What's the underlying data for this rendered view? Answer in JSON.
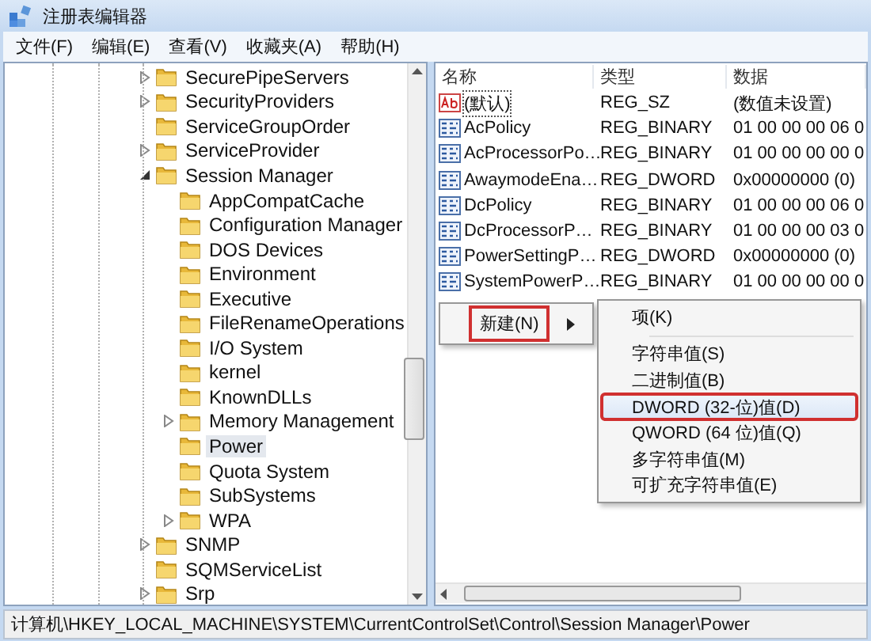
{
  "window": {
    "title": "注册表编辑器"
  },
  "menu": [
    "文件(F)",
    "编辑(E)",
    "查看(V)",
    "收藏夹(A)",
    "帮助(H)"
  ],
  "tree": {
    "items": [
      {
        "label": "SecurePipeServers",
        "expandable": true,
        "expanded": false,
        "selected": false
      },
      {
        "label": "SecurityProviders",
        "expandable": true,
        "expanded": false,
        "selected": false
      },
      {
        "label": "ServiceGroupOrder",
        "expandable": false,
        "selected": false
      },
      {
        "label": "ServiceProvider",
        "expandable": true,
        "expanded": false,
        "selected": false
      },
      {
        "label": "Session Manager",
        "expandable": true,
        "expanded": true,
        "selected": false,
        "children": [
          {
            "label": "AppCompatCache",
            "expandable": false,
            "selected": false
          },
          {
            "label": "Configuration Manager",
            "expandable": false,
            "selected": false
          },
          {
            "label": "DOS Devices",
            "expandable": false,
            "selected": false
          },
          {
            "label": "Environment",
            "expandable": false,
            "selected": false
          },
          {
            "label": "Executive",
            "expandable": false,
            "selected": false
          },
          {
            "label": "FileRenameOperations",
            "expandable": false,
            "selected": false
          },
          {
            "label": "I/O System",
            "expandable": false,
            "selected": false
          },
          {
            "label": "kernel",
            "expandable": false,
            "selected": false
          },
          {
            "label": "KnownDLLs",
            "expandable": false,
            "selected": false
          },
          {
            "label": "Memory Management",
            "expandable": true,
            "expanded": false,
            "selected": false
          },
          {
            "label": "Power",
            "expandable": false,
            "selected": true
          },
          {
            "label": "Quota System",
            "expandable": false,
            "selected": false
          },
          {
            "label": "SubSystems",
            "expandable": false,
            "selected": false
          },
          {
            "label": "WPA",
            "expandable": true,
            "expanded": false,
            "selected": false
          }
        ]
      },
      {
        "label": "SNMP",
        "expandable": true,
        "expanded": false,
        "selected": false
      },
      {
        "label": "SQMServiceList",
        "expandable": false,
        "selected": false
      },
      {
        "label": "Srp",
        "expandable": true,
        "expanded": false,
        "selected": false
      }
    ]
  },
  "list": {
    "columns": [
      "名称",
      "类型",
      "数据"
    ],
    "rows": [
      {
        "kind": "string",
        "name": "(默认)",
        "type": "REG_SZ",
        "data": "(数值未设置)",
        "focused": true
      },
      {
        "kind": "binary",
        "name": "AcPolicy",
        "type": "REG_BINARY",
        "data": "01 00 00 00 06 0",
        "focused": false
      },
      {
        "kind": "binary",
        "name": "AcProcessorPo…",
        "type": "REG_BINARY",
        "data": "01 00 00 00 00 0",
        "focused": false
      },
      {
        "kind": "binary",
        "name": "AwaymodeEna…",
        "type": "REG_DWORD",
        "data": "0x00000000 (0)",
        "focused": false
      },
      {
        "kind": "binary",
        "name": "DcPolicy",
        "type": "REG_BINARY",
        "data": "01 00 00 00 06 0",
        "focused": false
      },
      {
        "kind": "binary",
        "name": "DcProcessorP…",
        "type": "REG_BINARY",
        "data": "01 00 00 00 03 0",
        "focused": false
      },
      {
        "kind": "binary",
        "name": "PowerSettingP…",
        "type": "REG_DWORD",
        "data": "0x00000000 (0)",
        "focused": false
      },
      {
        "kind": "binary",
        "name": "SystemPowerP…",
        "type": "REG_BINARY",
        "data": "01 00 00 00 00 0",
        "focused": false
      }
    ]
  },
  "context_menu": {
    "items": [
      {
        "label": "新建(N)",
        "annotated": true,
        "submenu": true
      }
    ]
  },
  "submenu": {
    "items": [
      {
        "kind": "item",
        "label": "项(K)",
        "selected": false,
        "annotated": false
      },
      {
        "kind": "separator"
      },
      {
        "kind": "item",
        "label": "字符串值(S)",
        "selected": false,
        "annotated": false
      },
      {
        "kind": "item",
        "label": "二进制值(B)",
        "selected": false,
        "annotated": false
      },
      {
        "kind": "item",
        "label": "DWORD (32-位)值(D)",
        "selected": true,
        "annotated": true
      },
      {
        "kind": "item",
        "label": "QWORD (64 位)值(Q)",
        "selected": false,
        "annotated": false
      },
      {
        "kind": "item",
        "label": "多字符串值(M)",
        "selected": false,
        "annotated": false
      },
      {
        "kind": "item",
        "label": "可扩充字符串值(E)",
        "selected": false,
        "annotated": false
      }
    ]
  },
  "status_bar": "计算机\\HKEY_LOCAL_MACHINE\\SYSTEM\\CurrentControlSet\\Control\\Session Manager\\Power"
}
